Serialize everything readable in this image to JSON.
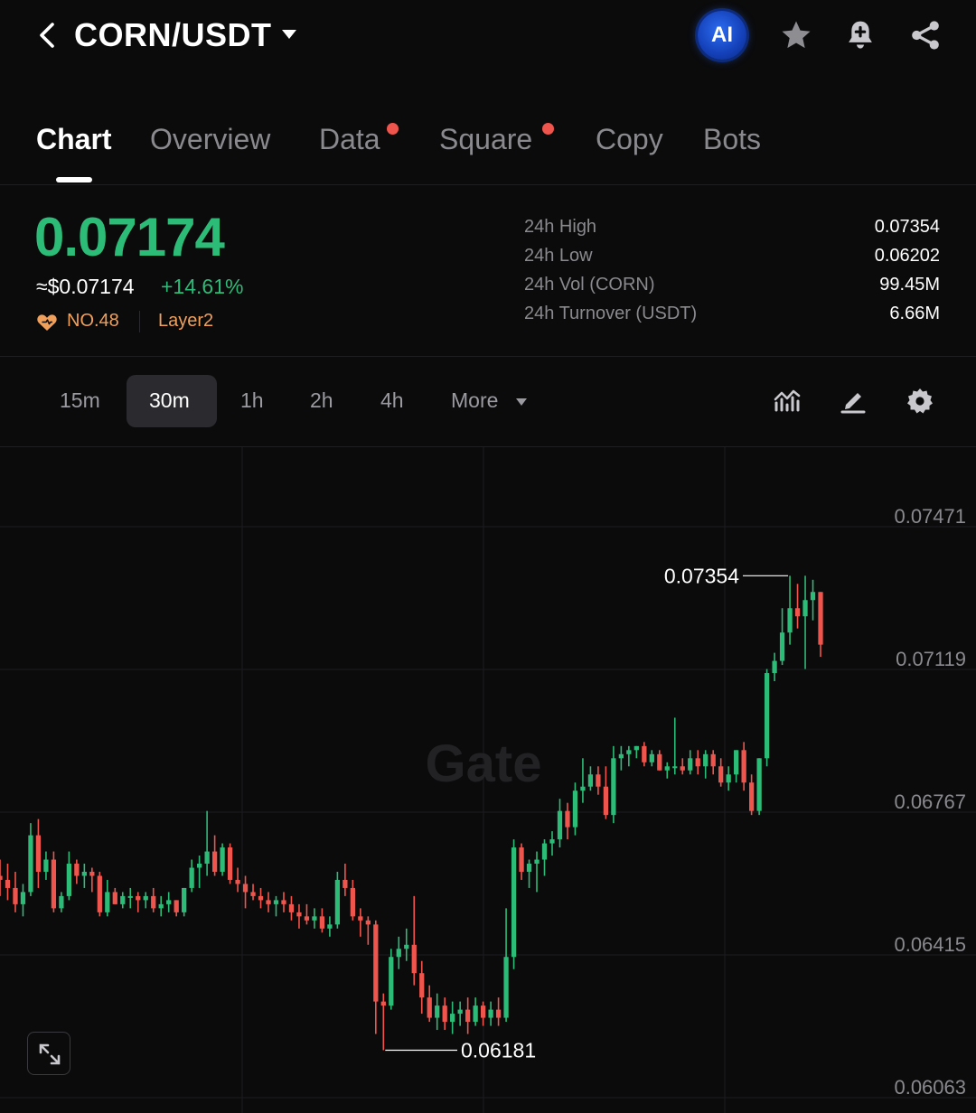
{
  "header": {
    "pair": "CORN/USDT",
    "ai_label": "AI"
  },
  "tabs": [
    {
      "label": "Chart",
      "active": true,
      "dot": false
    },
    {
      "label": "Overview",
      "active": false,
      "dot": false
    },
    {
      "label": "Data",
      "active": false,
      "dot": true
    },
    {
      "label": "Square",
      "active": false,
      "dot": true
    },
    {
      "label": "Copy",
      "active": false,
      "dot": false
    },
    {
      "label": "Bots",
      "active": false,
      "dot": false
    }
  ],
  "ticker": {
    "price": "0.07174",
    "fiat_price": "≈$0.07174",
    "change": "+14.61%",
    "rank": "NO.48",
    "tag": "Layer2",
    "up_color": "#2dbb78",
    "down_color": "#f0554d"
  },
  "stats": [
    {
      "label": "24h High",
      "value": "0.07354"
    },
    {
      "label": "24h Low",
      "value": "0.06202"
    },
    {
      "label": "24h Vol (CORN)",
      "value": "99.45M"
    },
    {
      "label": "24h Turnover (USDT)",
      "value": "6.66M"
    }
  ],
  "timeframes": {
    "options": [
      "15m",
      "30m",
      "1h",
      "2h",
      "4h"
    ],
    "selected": "30m",
    "more_label": "More"
  },
  "watermark": "Gate",
  "chart_data": {
    "type": "candlestick",
    "y_ticks": [
      "0.07471",
      "0.07119",
      "0.06767",
      "0.06415",
      "0.06063"
    ],
    "ylim": [
      0.06063,
      0.07471
    ],
    "max_label": "0.07354",
    "min_label": "0.06181",
    "candles": [
      [
        0.0661,
        0.0665,
        0.0656,
        0.066
      ],
      [
        0.066,
        0.0664,
        0.0655,
        0.0658
      ],
      [
        0.0658,
        0.0662,
        0.0652,
        0.0654
      ],
      [
        0.0654,
        0.0659,
        0.0651,
        0.0657
      ],
      [
        0.0657,
        0.0674,
        0.0656,
        0.0671
      ],
      [
        0.0671,
        0.0675,
        0.0658,
        0.0662
      ],
      [
        0.0662,
        0.0667,
        0.066,
        0.0665
      ],
      [
        0.0665,
        0.0667,
        0.0652,
        0.0653
      ],
      [
        0.0653,
        0.0657,
        0.0652,
        0.0656
      ],
      [
        0.0656,
        0.0667,
        0.0655,
        0.0664
      ],
      [
        0.0664,
        0.0665,
        0.0659,
        0.0661
      ],
      [
        0.0661,
        0.0664,
        0.0658,
        0.0662
      ],
      [
        0.0662,
        0.0663,
        0.0657,
        0.0661
      ],
      [
        0.0661,
        0.0662,
        0.0651,
        0.0652
      ],
      [
        0.0652,
        0.066,
        0.0651,
        0.0657
      ],
      [
        0.0657,
        0.0658,
        0.0654,
        0.0654
      ],
      [
        0.0654,
        0.0657,
        0.0653,
        0.0656
      ],
      [
        0.0656,
        0.0658,
        0.0653,
        0.0656
      ],
      [
        0.0656,
        0.0657,
        0.0652,
        0.0655
      ],
      [
        0.0655,
        0.0657,
        0.0653,
        0.0656
      ],
      [
        0.0656,
        0.0658,
        0.0652,
        0.0653
      ],
      [
        0.0653,
        0.0656,
        0.0651,
        0.0654
      ],
      [
        0.0654,
        0.0657,
        0.0652,
        0.0655
      ],
      [
        0.0655,
        0.0655,
        0.0651,
        0.0652
      ],
      [
        0.0652,
        0.0658,
        0.0651,
        0.0658
      ],
      [
        0.0658,
        0.0665,
        0.0657,
        0.0663
      ],
      [
        0.0663,
        0.0666,
        0.0658,
        0.0664
      ],
      [
        0.0664,
        0.0677,
        0.0661,
        0.0667
      ],
      [
        0.0667,
        0.0671,
        0.0661,
        0.0662
      ],
      [
        0.0662,
        0.0669,
        0.0661,
        0.0668
      ],
      [
        0.0668,
        0.0669,
        0.0659,
        0.066
      ],
      [
        0.066,
        0.0663,
        0.0657,
        0.0659
      ],
      [
        0.0659,
        0.0661,
        0.0653,
        0.0657
      ],
      [
        0.0657,
        0.0659,
        0.0655,
        0.0656
      ],
      [
        0.0656,
        0.0658,
        0.0653,
        0.0655
      ],
      [
        0.0655,
        0.0657,
        0.0652,
        0.0654
      ],
      [
        0.0654,
        0.0656,
        0.0651,
        0.0655
      ],
      [
        0.0655,
        0.0657,
        0.0652,
        0.0654
      ],
      [
        0.0654,
        0.0656,
        0.065,
        0.0652
      ],
      [
        0.0652,
        0.0654,
        0.0648,
        0.0651
      ],
      [
        0.0651,
        0.0654,
        0.0649,
        0.065
      ],
      [
        0.065,
        0.0653,
        0.0648,
        0.0651
      ],
      [
        0.0651,
        0.0653,
        0.0647,
        0.0648
      ],
      [
        0.0648,
        0.0651,
        0.0646,
        0.0649
      ],
      [
        0.0649,
        0.0662,
        0.0648,
        0.066
      ],
      [
        0.066,
        0.0664,
        0.0656,
        0.0658
      ],
      [
        0.0658,
        0.066,
        0.065,
        0.0651
      ],
      [
        0.0651,
        0.0653,
        0.0646,
        0.065
      ],
      [
        0.065,
        0.0651,
        0.0644,
        0.0649
      ],
      [
        0.0649,
        0.065,
        0.0622,
        0.063
      ],
      [
        0.063,
        0.0632,
        0.0618,
        0.0629
      ],
      [
        0.0629,
        0.0643,
        0.0628,
        0.0641
      ],
      [
        0.0641,
        0.0646,
        0.0638,
        0.0643
      ],
      [
        0.0643,
        0.0648,
        0.064,
        0.0644
      ],
      [
        0.0644,
        0.0656,
        0.0634,
        0.0637
      ],
      [
        0.0637,
        0.064,
        0.0627,
        0.0631
      ],
      [
        0.0631,
        0.0634,
        0.0625,
        0.0626
      ],
      [
        0.0626,
        0.0632,
        0.0623,
        0.0629
      ],
      [
        0.0629,
        0.0631,
        0.0623,
        0.0625
      ],
      [
        0.0625,
        0.063,
        0.0622,
        0.0627
      ],
      [
        0.0627,
        0.063,
        0.0624,
        0.0628
      ],
      [
        0.0628,
        0.0631,
        0.0622,
        0.0625
      ],
      [
        0.0625,
        0.0631,
        0.0624,
        0.0629
      ],
      [
        0.0629,
        0.063,
        0.0624,
        0.0626
      ],
      [
        0.0626,
        0.063,
        0.0624,
        0.0628
      ],
      [
        0.0628,
        0.0631,
        0.0624,
        0.0626
      ],
      [
        0.0626,
        0.0653,
        0.0625,
        0.0641
      ],
      [
        0.0641,
        0.067,
        0.0638,
        0.0668
      ],
      [
        0.0668,
        0.0669,
        0.066,
        0.0662
      ],
      [
        0.0662,
        0.0665,
        0.0658,
        0.0664
      ],
      [
        0.0664,
        0.0667,
        0.0657,
        0.0665
      ],
      [
        0.0665,
        0.067,
        0.0661,
        0.0669
      ],
      [
        0.0669,
        0.0672,
        0.0666,
        0.067
      ],
      [
        0.067,
        0.068,
        0.0668,
        0.0677
      ],
      [
        0.0677,
        0.0679,
        0.067,
        0.0673
      ],
      [
        0.0673,
        0.0684,
        0.0671,
        0.0682
      ],
      [
        0.0682,
        0.069,
        0.0679,
        0.0683
      ],
      [
        0.0683,
        0.0688,
        0.0682,
        0.0686
      ],
      [
        0.0686,
        0.0688,
        0.0681,
        0.0683
      ],
      [
        0.0683,
        0.0688,
        0.0675,
        0.0676
      ],
      [
        0.0676,
        0.0693,
        0.0674,
        0.069
      ],
      [
        0.069,
        0.0693,
        0.0687,
        0.0691
      ],
      [
        0.0691,
        0.0693,
        0.0688,
        0.0692
      ],
      [
        0.0692,
        0.0693,
        0.069,
        0.0693
      ],
      [
        0.0693,
        0.0694,
        0.0688,
        0.0689
      ],
      [
        0.0689,
        0.0692,
        0.0688,
        0.0691
      ],
      [
        0.0691,
        0.0692,
        0.0687,
        0.0687
      ],
      [
        0.0687,
        0.0689,
        0.0685,
        0.0688
      ],
      [
        0.0688,
        0.07,
        0.0686,
        0.0688
      ],
      [
        0.0688,
        0.069,
        0.0686,
        0.0687
      ],
      [
        0.0687,
        0.0692,
        0.0686,
        0.069
      ],
      [
        0.069,
        0.0692,
        0.0686,
        0.0688
      ],
      [
        0.0688,
        0.0692,
        0.0685,
        0.0691
      ],
      [
        0.0691,
        0.0692,
        0.0686,
        0.0688
      ],
      [
        0.0688,
        0.069,
        0.0683,
        0.0684
      ],
      [
        0.0684,
        0.0688,
        0.0682,
        0.0686
      ],
      [
        0.0686,
        0.0692,
        0.0684,
        0.0692
      ],
      [
        0.0692,
        0.0694,
        0.0682,
        0.0684
      ],
      [
        0.0684,
        0.0686,
        0.0676,
        0.0677
      ],
      [
        0.0677,
        0.069,
        0.0676,
        0.069
      ],
      [
        0.069,
        0.0712,
        0.0688,
        0.0711
      ],
      [
        0.0711,
        0.0716,
        0.0709,
        0.0714
      ],
      [
        0.0714,
        0.0727,
        0.0713,
        0.0721
      ],
      [
        0.0721,
        0.0735,
        0.0718,
        0.0727
      ],
      [
        0.0727,
        0.0733,
        0.0722,
        0.0725
      ],
      [
        0.0725,
        0.0735,
        0.0712,
        0.0729
      ],
      [
        0.0729,
        0.0734,
        0.0724,
        0.0731
      ],
      [
        0.0731,
        0.0731,
        0.0715,
        0.0718
      ]
    ]
  }
}
